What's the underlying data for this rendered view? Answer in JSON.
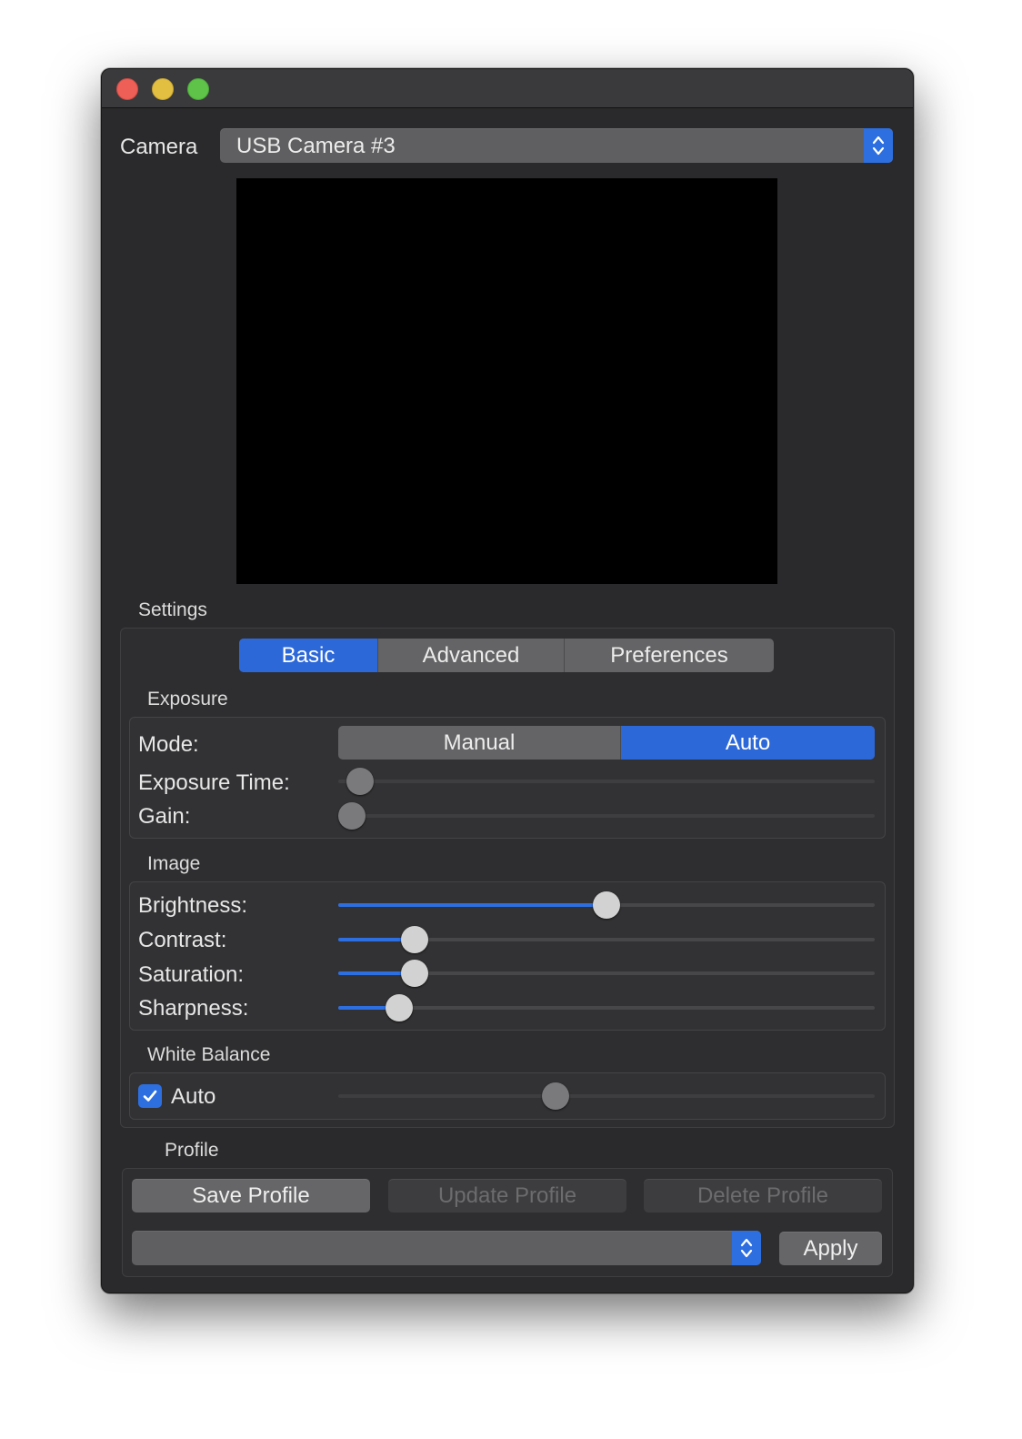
{
  "camera": {
    "label": "Camera",
    "selected": "USB Camera #3"
  },
  "settings": {
    "title": "Settings",
    "tabs": [
      {
        "label": "Basic",
        "active": true
      },
      {
        "label": "Advanced",
        "active": false
      },
      {
        "label": "Preferences",
        "active": false
      }
    ]
  },
  "exposure": {
    "title": "Exposure",
    "mode_label": "Mode:",
    "mode_options": [
      {
        "label": "Manual",
        "active": false
      },
      {
        "label": "Auto",
        "active": true
      }
    ],
    "exposure_time_label": "Exposure Time:",
    "exposure_time_value": 0.04,
    "gain_label": "Gain:",
    "gain_value": 0.025
  },
  "image": {
    "title": "Image",
    "brightness_label": "Brightness:",
    "brightness_value": 0.5,
    "contrast_label": "Contrast:",
    "contrast_value": 0.143,
    "saturation_label": "Saturation:",
    "saturation_value": 0.143,
    "sharpness_label": "Sharpness:",
    "sharpness_value": 0.113
  },
  "white_balance": {
    "title": "White Balance",
    "auto_label": "Auto",
    "auto_checked": true,
    "temperature_value": 0.405
  },
  "profile": {
    "title": "Profile",
    "save_label": "Save Profile",
    "update_label": "Update Profile",
    "delete_label": "Delete Profile",
    "selected": "",
    "apply_label": "Apply"
  },
  "colors": {
    "accent": "#2d6fe0",
    "window_bg": "#2a2a2c",
    "close": "#ed5f57",
    "minimize": "#e3bf41",
    "zoom": "#5ec348"
  },
  "icons": {
    "popup_stepper": "chevron-up-down-icon",
    "checkbox": "checkmark-icon"
  }
}
